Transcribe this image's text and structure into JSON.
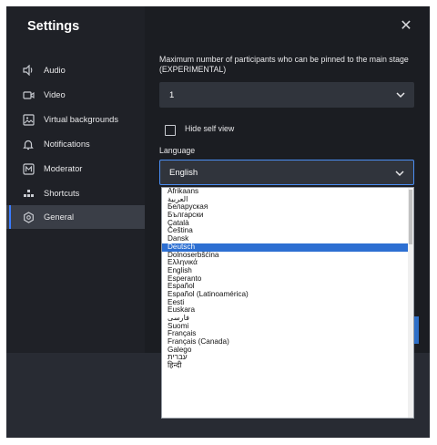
{
  "sidebar": {
    "title": "Settings",
    "items": [
      {
        "label": "Audio",
        "icon": "speaker-icon"
      },
      {
        "label": "Video",
        "icon": "camera-icon"
      },
      {
        "label": "Virtual backgrounds",
        "icon": "image-icon"
      },
      {
        "label": "Notifications",
        "icon": "bell-icon"
      },
      {
        "label": "Moderator",
        "icon": "moderator-icon"
      },
      {
        "label": "Shortcuts",
        "icon": "shortcuts-icon"
      },
      {
        "label": "General",
        "icon": "gear-icon",
        "active": true
      }
    ]
  },
  "general": {
    "pinned_label": "Maximum number of participants who can be pinned to the main stage (EXPERIMENTAL)",
    "pinned_value": "1",
    "hide_self_view_label": "Hide self view",
    "hide_self_view_checked": false,
    "language_label": "Language",
    "language_value": "English"
  },
  "language_options": [
    "Afrikaans",
    "العربية",
    "Беларуская",
    "Български",
    "Català",
    "Čeština",
    "Dansk",
    "Deutsch",
    "Dolnoserbšćina",
    "Ελληνικά",
    "English",
    "Esperanto",
    "Español",
    "Español (Latinoamérica)",
    "Eesti",
    "Euskara",
    "فارسی",
    "Suomi",
    "Français",
    "Français (Canada)",
    "Galego",
    "עברית",
    "हिन्दी"
  ],
  "highlighted_option": "Deutsch",
  "colors": {
    "accent": "#3a7cff",
    "dialog_bg": "#1b1d22",
    "select_bg": "#30343c",
    "highlight": "#2d6fd2"
  }
}
